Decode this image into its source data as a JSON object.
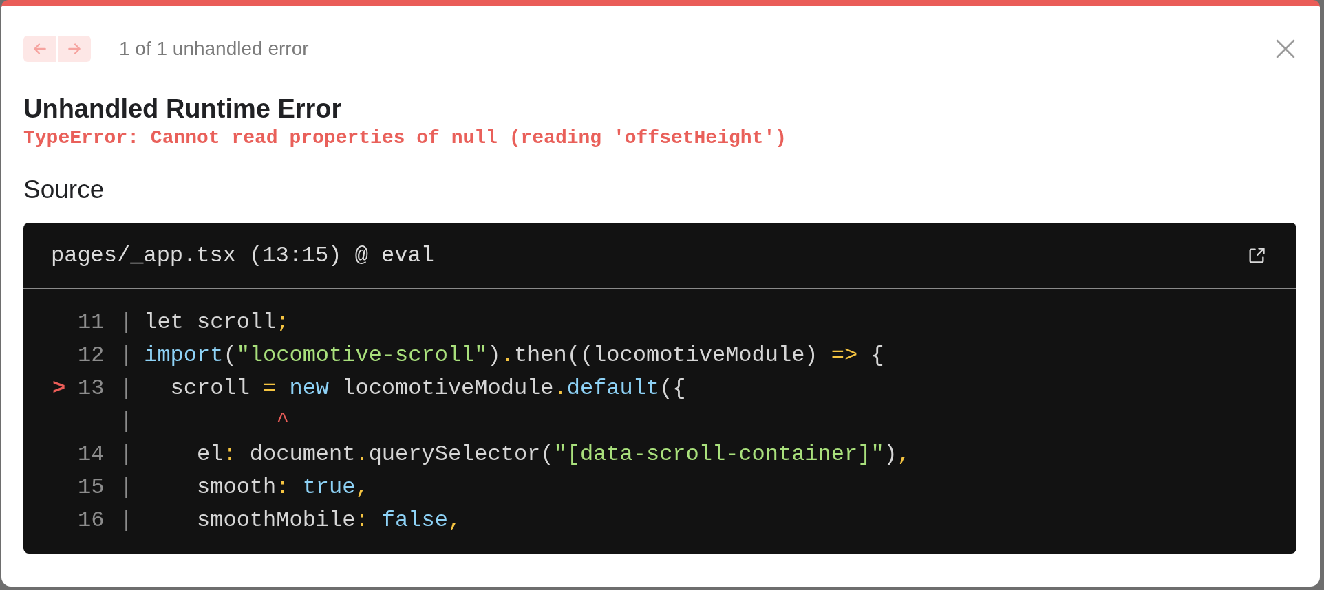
{
  "navigation": [
    {
      "kind": "previous",
      "disabled": true
    },
    {
      "kind": "next",
      "disabled": true
    }
  ],
  "counter": "1 of 1 unhandled error",
  "title": "Unhandled Runtime Error",
  "message": "TypeError: Cannot read properties of null (reading 'offsetHeight')",
  "section_heading": "Source",
  "code_frame": {
    "file": "pages/_app.tsx (13:15) @ eval",
    "lines": [
      {
        "number": "11",
        "separator": "|",
        "tokens": [
          {
            "text": "let scroll",
            "kind": "plain"
          },
          {
            "text": ";",
            "kind": "punct"
          }
        ]
      },
      {
        "number": "12",
        "separator": "|",
        "tokens": [
          {
            "text": "import",
            "kind": "keyword"
          },
          {
            "text": "(",
            "kind": "plain"
          },
          {
            "text": "\"locomotive-scroll\"",
            "kind": "string"
          },
          {
            "text": ")",
            "kind": "plain"
          },
          {
            "text": ".",
            "kind": "punct"
          },
          {
            "text": "then((locomotiveModule) ",
            "kind": "plain"
          },
          {
            "text": "=>",
            "kind": "punct"
          },
          {
            "text": " {",
            "kind": "plain"
          }
        ]
      },
      {
        "marker": ">",
        "number": "13",
        "separator": "|",
        "tokens": [
          {
            "text": "  scroll ",
            "kind": "plain"
          },
          {
            "text": "=",
            "kind": "punct"
          },
          {
            "text": " new",
            "kind": "keyword"
          },
          {
            "text": " locomotiveModule",
            "kind": "plain"
          },
          {
            "text": ".",
            "kind": "punct"
          },
          {
            "text": "default",
            "kind": "keyword"
          },
          {
            "text": "({",
            "kind": "plain"
          }
        ]
      },
      {
        "separator": "|",
        "tokens": [
          {
            "text": "          ^",
            "kind": "caret"
          }
        ]
      },
      {
        "number": "14",
        "separator": "|",
        "tokens": [
          {
            "text": "    el",
            "kind": "plain"
          },
          {
            "text": ":",
            "kind": "punct"
          },
          {
            "text": " document",
            "kind": "plain"
          },
          {
            "text": ".",
            "kind": "punct"
          },
          {
            "text": "querySelector(",
            "kind": "plain"
          },
          {
            "text": "\"[data-scroll-container]\"",
            "kind": "string"
          },
          {
            "text": ")",
            "kind": "plain"
          },
          {
            "text": ",",
            "kind": "punct"
          }
        ]
      },
      {
        "number": "15",
        "separator": "|",
        "tokens": [
          {
            "text": "    smooth",
            "kind": "plain"
          },
          {
            "text": ":",
            "kind": "punct"
          },
          {
            "text": " true",
            "kind": "keyword"
          },
          {
            "text": ",",
            "kind": "punct"
          }
        ]
      },
      {
        "number": "16",
        "separator": "|",
        "tokens": [
          {
            "text": "    smoothMobile",
            "kind": "plain"
          },
          {
            "text": ":",
            "kind": "punct"
          },
          {
            "text": " false",
            "kind": "keyword"
          },
          {
            "text": ",",
            "kind": "punct"
          }
        ]
      }
    ]
  }
}
